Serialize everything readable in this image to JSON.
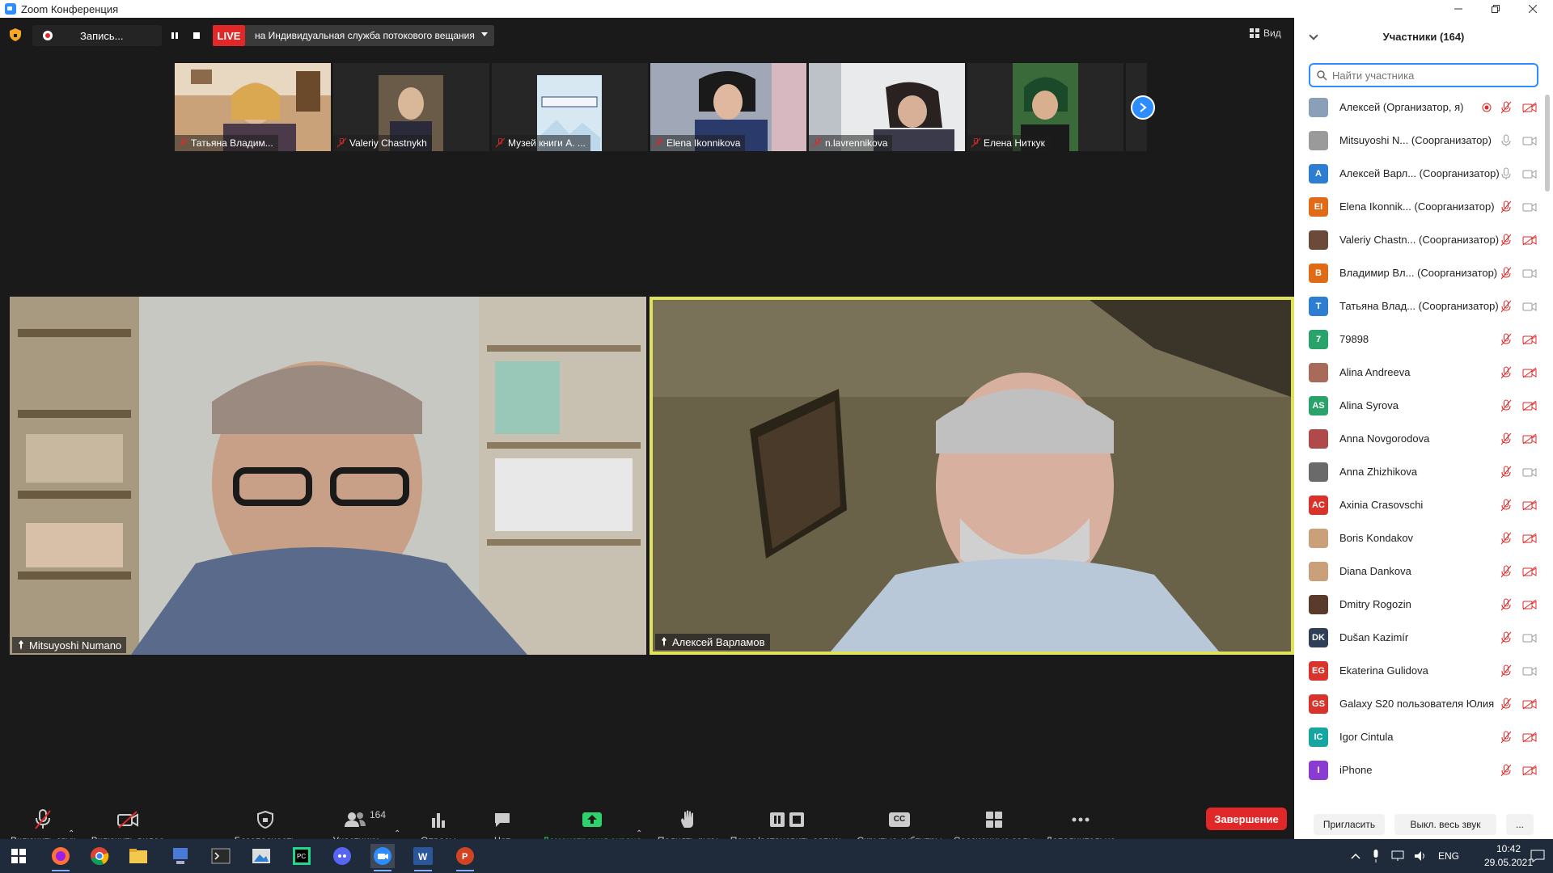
{
  "window": {
    "title": "Zoom Конференция"
  },
  "topbar": {
    "recording_label": "Запись...",
    "live_badge": "LIVE",
    "live_target": "на Индивидуальная служба потокового вещания",
    "view_label": "Вид"
  },
  "thumbnails": [
    {
      "name": "Татьяна Владим..."
    },
    {
      "name": "Valeriy Chastnykh"
    },
    {
      "name": "Музей книги А. ..."
    },
    {
      "name": "Elena Ikonnikova"
    },
    {
      "name": "n.lavrennikova"
    },
    {
      "name": "Елена Ниткук"
    }
  ],
  "videos": {
    "left": {
      "name": "Mitsuyoshi Numano"
    },
    "right": {
      "name": "Алексей Варламов"
    }
  },
  "toolbar": {
    "unmute": "Включить звук",
    "start_video": "Включить видео",
    "security": "Безопасность",
    "participants": "Участники",
    "participants_count": "164",
    "polls": "Опросы",
    "chat": "Чат",
    "share_screen": "Демонстрация экрана",
    "raise_hand": "Поднять руку",
    "pause_record": "Пауза/остановить запись",
    "captions": "Скрытые субтитры",
    "breakout": "Сессионные залы",
    "more": "Дополнительно",
    "end": "Завершение",
    "captions_icon": "CC"
  },
  "panel": {
    "title": "Участники (164)",
    "search_placeholder": "Найти участника",
    "invite": "Пригласить",
    "mute_all": "Выкл. весь звук",
    "more": "...",
    "participants": [
      {
        "name": "Алексей (Организатор, я)",
        "role": "",
        "avatar": "",
        "color": "#8aa0b8",
        "mic": "off",
        "cam": "off",
        "rec": true
      },
      {
        "name": "Mitsuyoshi N...",
        "role": "(Соорганизатор)",
        "avatar": "",
        "color": "#9a9a9a",
        "mic": "on",
        "cam": "on"
      },
      {
        "name": "Алексей Варл...",
        "role": "(Соорганизатор)",
        "avatar": "A",
        "color": "#2d7dd2",
        "mic": "on",
        "cam": "on"
      },
      {
        "name": "Elena Ikonnik...",
        "role": "(Соорганизатор)",
        "avatar": "EI",
        "color": "#e06b16",
        "mic": "off",
        "cam": "on"
      },
      {
        "name": "Valeriy Chastn...",
        "role": "(Соорганизатор)",
        "avatar": "",
        "color": "#6b4a3a",
        "mic": "off",
        "cam": "off"
      },
      {
        "name": "Владимир Вл...",
        "role": "(Соорганизатор)",
        "avatar": "B",
        "color": "#e06b16",
        "mic": "off",
        "cam": "on"
      },
      {
        "name": "Татьяна Влад...",
        "role": "(Соорганизатор)",
        "avatar": "T",
        "color": "#2d7dd2",
        "mic": "off",
        "cam": "on"
      },
      {
        "name": "79898",
        "role": "",
        "avatar": "7",
        "color": "#2aa36b",
        "mic": "off",
        "cam": "off"
      },
      {
        "name": "Alina Andreeva",
        "role": "",
        "avatar": "",
        "color": "#a86b5a",
        "mic": "off",
        "cam": "off"
      },
      {
        "name": "Alina Syrova",
        "role": "",
        "avatar": "AS",
        "color": "#2aa36b",
        "mic": "off",
        "cam": "off"
      },
      {
        "name": "Anna Novgorodova",
        "role": "",
        "avatar": "",
        "color": "#b04a4a",
        "mic": "off",
        "cam": "off"
      },
      {
        "name": "Anna Zhizhikova",
        "role": "",
        "avatar": "",
        "color": "#6a6a6a",
        "mic": "off",
        "cam": "on"
      },
      {
        "name": "Axinia Crasovschi",
        "role": "",
        "avatar": "AC",
        "color": "#d9342b",
        "mic": "off",
        "cam": "off"
      },
      {
        "name": "Boris Kondakov",
        "role": "",
        "avatar": "",
        "color": "#c9a07a",
        "mic": "off",
        "cam": "off"
      },
      {
        "name": "Diana Dankova",
        "role": "",
        "avatar": "",
        "color": "#c9a07a",
        "mic": "off",
        "cam": "off"
      },
      {
        "name": "Dmitry Rogozin",
        "role": "",
        "avatar": "",
        "color": "#5a3a2a",
        "mic": "off",
        "cam": "off"
      },
      {
        "name": "Dušan Kazimír",
        "role": "",
        "avatar": "DK",
        "color": "#2f3f57",
        "mic": "off",
        "cam": "on"
      },
      {
        "name": "Ekaterina Gulidova",
        "role": "",
        "avatar": "EG",
        "color": "#d9342b",
        "mic": "off",
        "cam": "on"
      },
      {
        "name": "Galaxy S20 пользователя Юлия",
        "role": "",
        "avatar": "GS",
        "color": "#d9342b",
        "mic": "off",
        "cam": "off"
      },
      {
        "name": "Igor Cintula",
        "role": "",
        "avatar": "IC",
        "color": "#17a5a0",
        "mic": "off",
        "cam": "off"
      },
      {
        "name": "iPhone",
        "role": "",
        "avatar": "I",
        "color": "#8a3bd1",
        "mic": "off",
        "cam": "off"
      }
    ]
  },
  "taskbar": {
    "lang": "ENG",
    "time": "10:42",
    "date": "29.05.2021"
  }
}
